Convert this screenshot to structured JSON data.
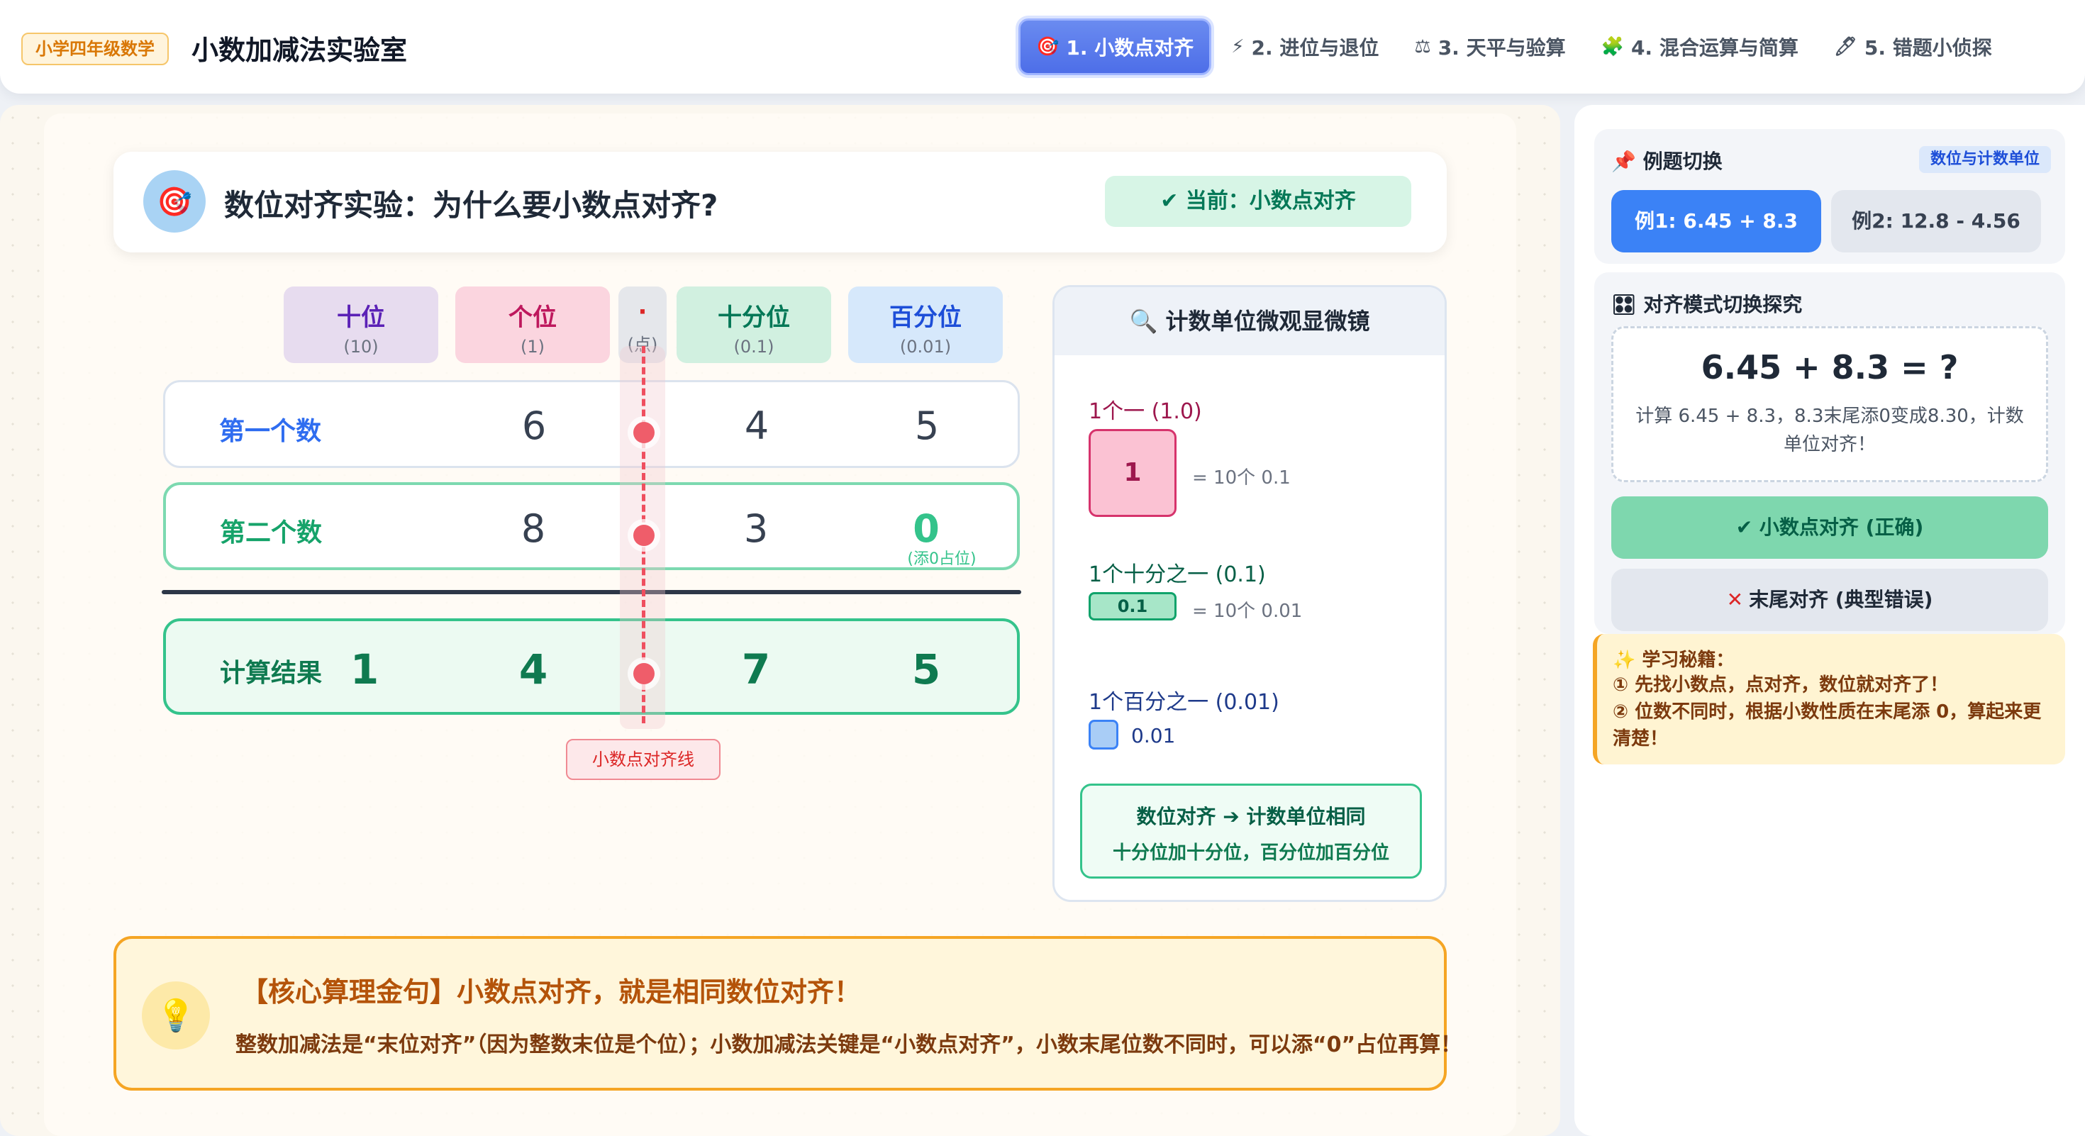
{
  "header": {
    "grade_badge": "小学四年级数学",
    "app_title": "小数加减法实验室",
    "tabs": [
      {
        "icon": "🎯",
        "label": "1. 小数点对齐"
      },
      {
        "icon": "⚡",
        "label": "2. 进位与退位"
      },
      {
        "icon": "⚖",
        "label": "3. 天平与验算"
      },
      {
        "icon": "🧩",
        "label": "4. 混合运算与简算"
      },
      {
        "icon": "🖊",
        "label": "5. 错题小侦探"
      }
    ]
  },
  "experiment": {
    "icon": "🎯",
    "title": "数位对齐实验：为什么要小数点对齐?",
    "current_badge": "✔ 当前：小数点对齐",
    "places": [
      {
        "name": "十位",
        "unit": "(10)"
      },
      {
        "name": "个位",
        "unit": "(1)"
      },
      {
        "name": "·",
        "unit": "(点)"
      },
      {
        "name": "十分位",
        "unit": "(0.1)"
      },
      {
        "name": "百分位",
        "unit": "(0.01)"
      }
    ],
    "row1": {
      "label": "第一个数",
      "ones": "6",
      "tenths": "4",
      "hundredths": "5"
    },
    "row2": {
      "label": "第二个数",
      "ones": "8",
      "tenths": "3",
      "hundredths": "0",
      "pad_note": "(添0占位)"
    },
    "result": {
      "label": "计算结果",
      "tens": "1",
      "ones": "4",
      "tenths": "7",
      "hundredths": "5"
    },
    "dot_tag": "小数点对齐线"
  },
  "microscope": {
    "title": "🔍 计数单位微观显微镜",
    "one_label": "1个一 (1.0)",
    "one_box": "1",
    "one_eq": "= 10个 0.1",
    "tenth_label": "1个十分之一 (0.1)",
    "tenth_box": "0.1",
    "tenth_eq": "= 10个 0.01",
    "hund_label": "1个百分之一 (0.01)",
    "hund_val": "0.01",
    "summary_1": "数位对齐 ➔ 计数单位相同",
    "summary_2": "十分位加十分位，百分位加百分位"
  },
  "core": {
    "icon": "💡",
    "title": "【核心算理金句】小数点对齐，就是相同数位对齐！",
    "text": "整数加减法是“末位对齐”（因为整数末位是个位）；小数加减法关键是“小数点对齐”，小数末尾位数不同时，可以添“0”占位再算！"
  },
  "sidebar": {
    "example_title": "📌 例题切换",
    "example_badge": "数位与计数单位",
    "example_1": "例1: 6.45 + 8.3",
    "example_2": "例2: 12.8 - 4.56",
    "mode_title": "🎛 对齐模式切换探究",
    "equation": "6.45 + 8.3 = ?",
    "hint": "计算 6.45 + 8.3，8.3末尾添0变成8.30，计数单位对齐！",
    "mode_ok": "✔ 小数点对齐 (正确)",
    "mode_bad_x": "✕",
    "mode_bad": "末尾对齐 (典型错误)",
    "tip_title": "✨ 学习秘籍：",
    "tip_1": "① 先找小数点，点对齐，数位就对齐了！",
    "tip_2": "② 位数不同时，根据小数性质在末尾添 0，算起来更清楚！"
  },
  "colors": {
    "accent": "#4d6ee8",
    "success": "#34c38b",
    "warning": "#f5a524",
    "danger": "#ef4f5f"
  }
}
